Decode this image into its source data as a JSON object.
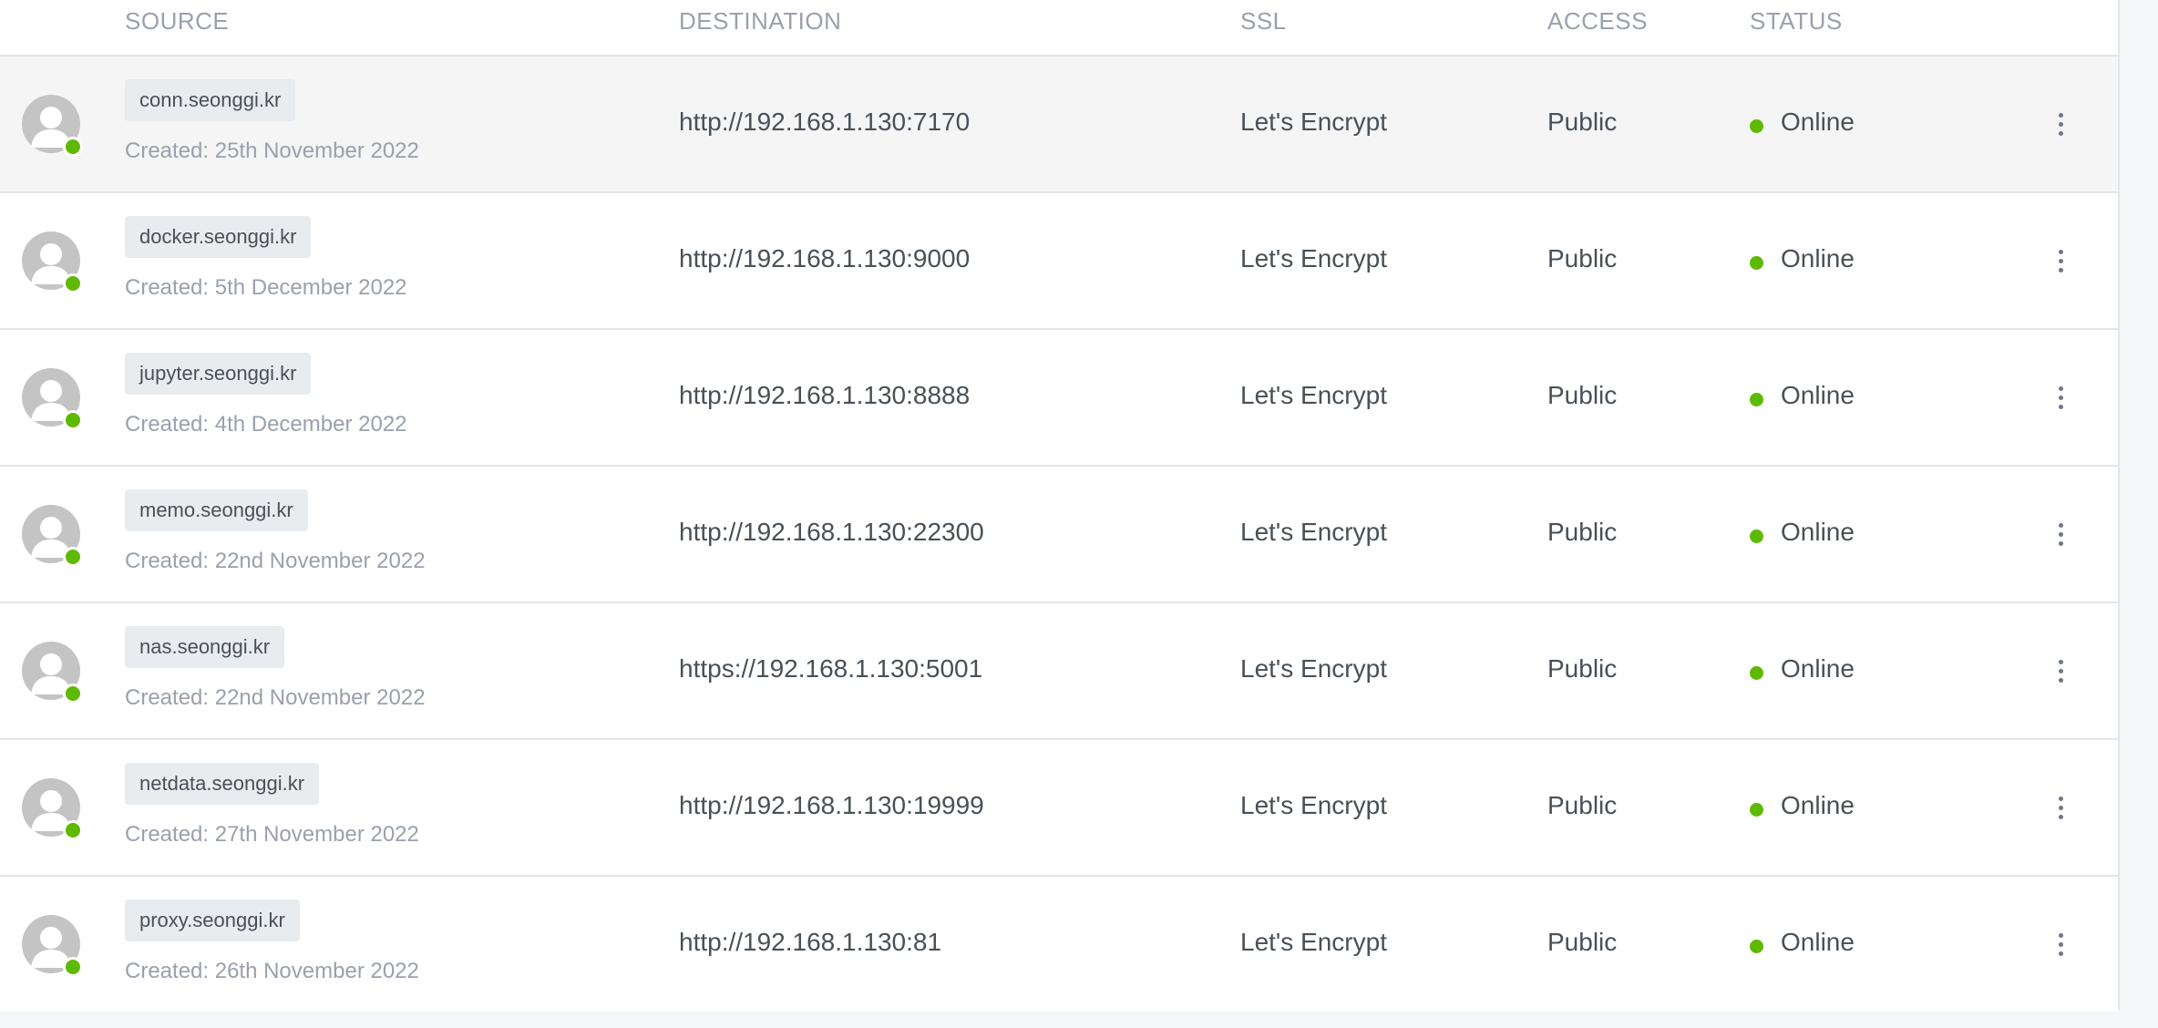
{
  "table": {
    "headers": {
      "source": "SOURCE",
      "destination": "DESTINATION",
      "ssl": "SSL",
      "access": "ACCESS",
      "status": "STATUS"
    },
    "rows": [
      {
        "source": "conn.seonggi.kr",
        "created": "Created: 25th November 2022",
        "destination": "http://192.168.1.130:7170",
        "ssl": "Let's Encrypt",
        "access": "Public",
        "status": "Online"
      },
      {
        "source": "docker.seonggi.kr",
        "created": "Created: 5th December 2022",
        "destination": "http://192.168.1.130:9000",
        "ssl": "Let's Encrypt",
        "access": "Public",
        "status": "Online"
      },
      {
        "source": "jupyter.seonggi.kr",
        "created": "Created: 4th December 2022",
        "destination": "http://192.168.1.130:8888",
        "ssl": "Let's Encrypt",
        "access": "Public",
        "status": "Online"
      },
      {
        "source": "memo.seonggi.kr",
        "created": "Created: 22nd November 2022",
        "destination": "http://192.168.1.130:22300",
        "ssl": "Let's Encrypt",
        "access": "Public",
        "status": "Online"
      },
      {
        "source": "nas.seonggi.kr",
        "created": "Created: 22nd November 2022",
        "destination": "https://192.168.1.130:5001",
        "ssl": "Let's Encrypt",
        "access": "Public",
        "status": "Online"
      },
      {
        "source": "netdata.seonggi.kr",
        "created": "Created: 27th November 2022",
        "destination": "http://192.168.1.130:19999",
        "ssl": "Let's Encrypt",
        "access": "Public",
        "status": "Online"
      },
      {
        "source": "proxy.seonggi.kr",
        "created": "Created: 26th November 2022",
        "destination": "http://192.168.1.130:81",
        "ssl": "Let's Encrypt",
        "access": "Public",
        "status": "Online"
      }
    ]
  },
  "icons": {
    "avatar": "user-avatar-icon",
    "status_dot": "status-dot-icon",
    "menu": "kebab-menu-icon"
  },
  "colors": {
    "online": "#5eba00",
    "header_text": "#9aa0ac",
    "body_text": "#495057",
    "hover_row": "#f5f5f5"
  }
}
